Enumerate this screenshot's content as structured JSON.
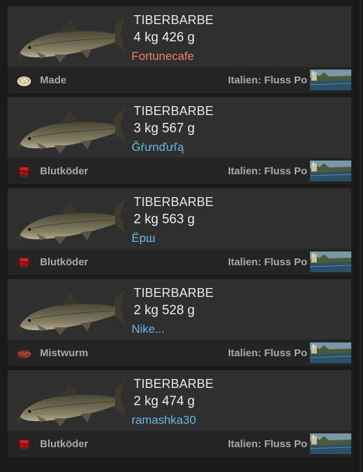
{
  "colors": {
    "angler_highlight": "#f08060",
    "angler_link": "#69b7e6",
    "card_bg": "#2f2f2f",
    "footer_bg": "#242424"
  },
  "catches": [
    {
      "species": "TIBERBARBE",
      "weight": "4 kg 426 g",
      "angler": "Fortunecafe",
      "angler_color": "#f08060",
      "bait": "Made",
      "bait_icon": "maggots-icon",
      "location": "Italien: Fluss Po"
    },
    {
      "species": "TIBERBARBE",
      "weight": "3 kg 567 g",
      "angler": "Ğŕưnďưľą",
      "angler_color": "#69b7e6",
      "bait": "Blutköder",
      "bait_icon": "blood-bait-icon",
      "location": "Italien: Fluss Po"
    },
    {
      "species": "TIBERBARBE",
      "weight": "2 kg 563 g",
      "angler": "Ёрш",
      "angler_color": "#69b7e6",
      "bait": "Blutköder",
      "bait_icon": "blood-bait-icon",
      "location": "Italien: Fluss Po"
    },
    {
      "species": "TIBERBARBE",
      "weight": "2 kg 528 g",
      "angler": "Nike...",
      "angler_color": "#69b7e6",
      "bait": "Mistwurm",
      "bait_icon": "dungworm-icon",
      "location": "Italien: Fluss Po"
    },
    {
      "species": "TIBERBARBE",
      "weight": "2 kg 474 g",
      "angler": "ramashka30",
      "angler_color": "#69b7e6",
      "bait": "Blutköder",
      "bait_icon": "blood-bait-icon",
      "location": "Italien: Fluss Po"
    }
  ]
}
